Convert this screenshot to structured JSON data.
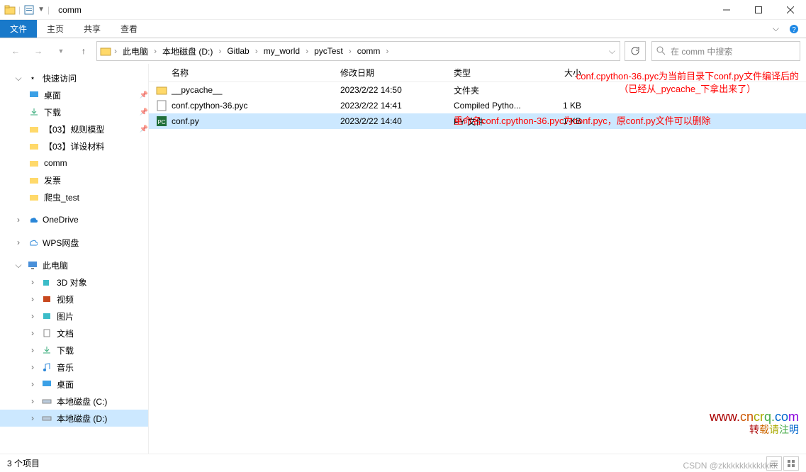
{
  "window": {
    "title": "comm"
  },
  "ribbon": {
    "file": "文件",
    "home": "主页",
    "share": "共享",
    "view": "查看"
  },
  "breadcrumb": [
    "此电脑",
    "本地磁盘 (D:)",
    "Gitlab",
    "my_world",
    "pycTest",
    "comm"
  ],
  "search": {
    "placeholder": "在 comm 中搜索"
  },
  "sidebar": {
    "quickaccess": "快速访问",
    "desktop": "桌面",
    "downloads": "下载",
    "rulemodel": "【03】规则模型",
    "designmat": "【03】详设材料",
    "comm": "comm",
    "invoice": "发票",
    "spider": "爬虫_test",
    "onedrive": "OneDrive",
    "wps": "WPS网盘",
    "thispc": "此电脑",
    "obj3d": "3D 对象",
    "video": "视频",
    "pictures": "图片",
    "documents": "文档",
    "downloads2": "下载",
    "music": "音乐",
    "desktop2": "桌面",
    "diskc": "本地磁盘 (C:)",
    "diskd": "本地磁盘 (D:)"
  },
  "columns": {
    "name": "名称",
    "date": "修改日期",
    "type": "类型",
    "size": "大小"
  },
  "files": [
    {
      "name": "__pycache__",
      "date": "2023/2/22 14:50",
      "type": "文件夹",
      "size": ""
    },
    {
      "name": "conf.cpython-36.pyc",
      "date": "2023/2/22 14:41",
      "type": "Compiled Pytho...",
      "size": "1 KB"
    },
    {
      "name": "conf.py",
      "date": "2023/2/22 14:40",
      "type": "PY 文件",
      "size": "1 KB"
    }
  ],
  "annotations": {
    "a1l1": "conf.cpython-36.pyc为当前目录下conf.py文件编译后的",
    "a1l2": "（已经从_pycache_下拿出来了）",
    "a2": "重命名conf.cpython-36.pyc为conf.pyc，原conf.py文件可以删除"
  },
  "status": {
    "count": "3 个项目"
  },
  "watermark": {
    "url": "www.cncrq.com",
    "tag": "转载请注明",
    "csdn": "CSDN @zkkkkkkkkkkkkk"
  }
}
